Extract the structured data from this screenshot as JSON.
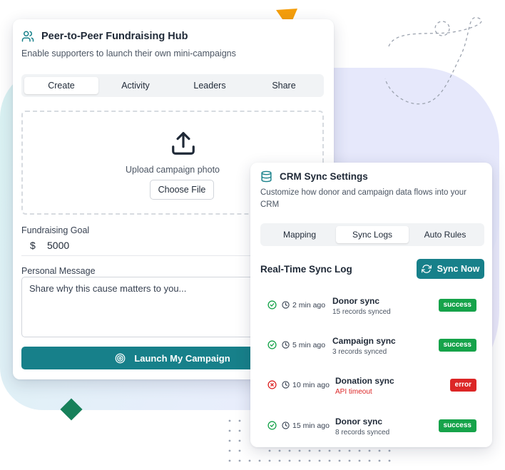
{
  "colors": {
    "primary_teal": "#17808a",
    "success_green": "#16a34a",
    "error_red": "#dc2626",
    "accent_orange": "#f59e0b",
    "accent_green": "#17805a"
  },
  "fundraising": {
    "icon": "users-icon",
    "title": "Peer-to-Peer Fundraising Hub",
    "subtitle": "Enable supporters to launch their own mini-campaigns",
    "tabs": [
      {
        "label": "Create",
        "active": true
      },
      {
        "label": "Activity",
        "active": false
      },
      {
        "label": "Leaders",
        "active": false
      },
      {
        "label": "Share",
        "active": false
      }
    ],
    "upload": {
      "icon": "upload-icon",
      "text": "Upload campaign photo",
      "button_label": "Choose File"
    },
    "goal": {
      "label": "Fundraising Goal",
      "currency": "$",
      "value": "5000"
    },
    "message": {
      "label": "Personal Message",
      "placeholder": "Share why this cause matters to you..."
    },
    "launch_button": {
      "icon": "target-icon",
      "label": "Launch My Campaign"
    }
  },
  "crm": {
    "icon": "database-icon",
    "title": "CRM Sync Settings",
    "subtitle": "Customize how donor and campaign data flows into your CRM",
    "tabs": [
      {
        "label": "Mapping",
        "active": false
      },
      {
        "label": "Sync Logs",
        "active": true
      },
      {
        "label": "Auto Rules",
        "active": false
      }
    ],
    "log_title": "Real-Time Sync Log",
    "sync_button": {
      "icon": "refresh-icon",
      "label": "Sync Now"
    },
    "logs": [
      {
        "status": "success",
        "status_icon": "check-circle-icon",
        "time": "2 min ago",
        "name": "Donor sync",
        "detail": "15 records synced",
        "badge": "success"
      },
      {
        "status": "success",
        "status_icon": "check-circle-icon",
        "time": "5 min ago",
        "name": "Campaign sync",
        "detail": "3 records synced",
        "badge": "success"
      },
      {
        "status": "error",
        "status_icon": "x-circle-icon",
        "time": "10 min ago",
        "name": "Donation sync",
        "detail": "API timeout",
        "badge": "error"
      },
      {
        "status": "success",
        "status_icon": "check-circle-icon",
        "time": "15 min ago",
        "name": "Donor sync",
        "detail": "8 records synced",
        "badge": "success"
      }
    ]
  }
}
